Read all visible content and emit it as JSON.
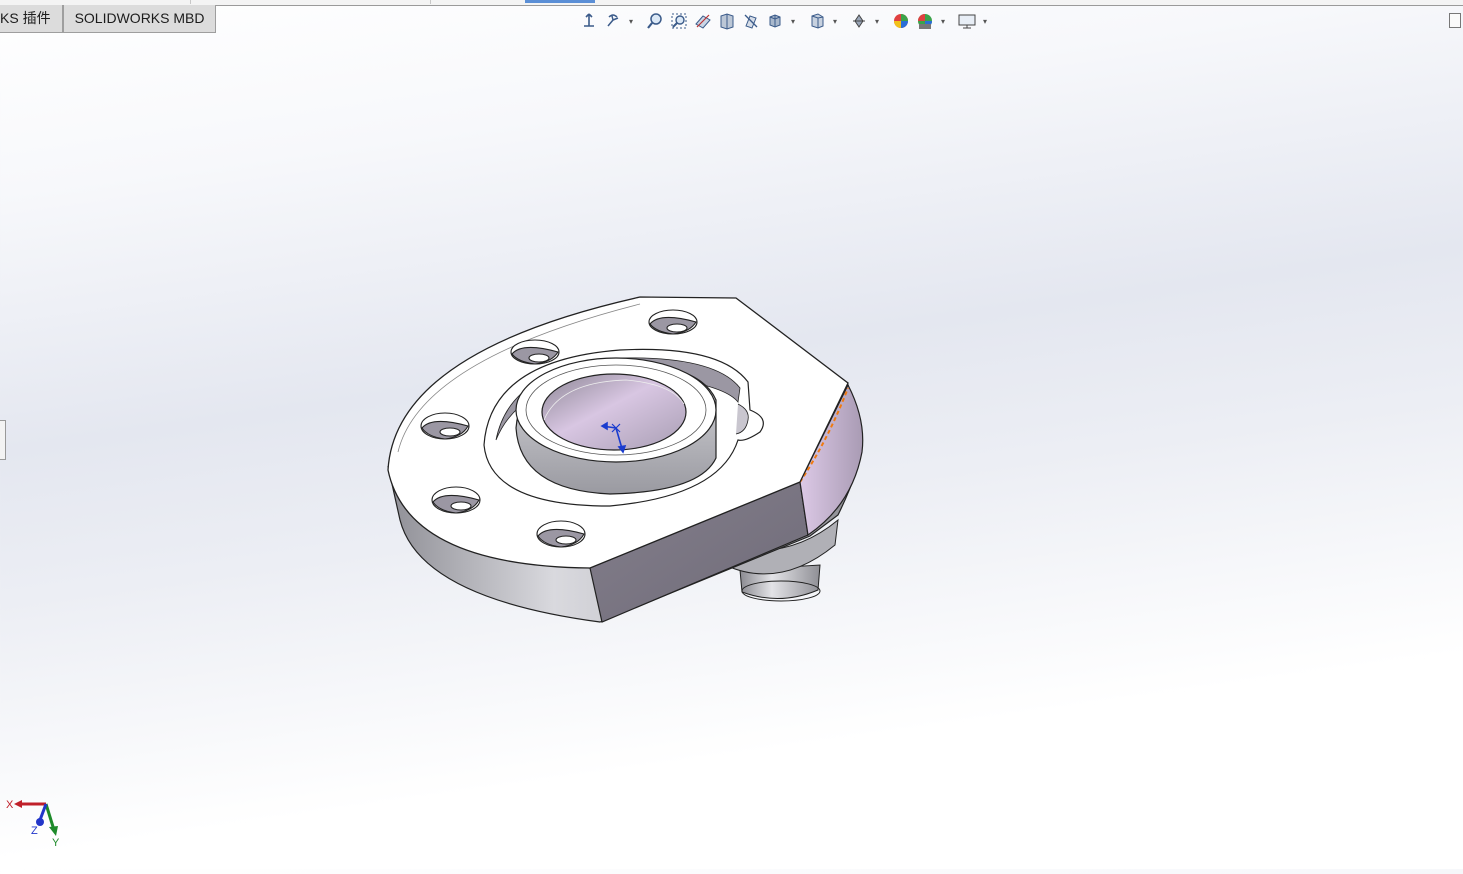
{
  "tabs": [
    {
      "label": "KS 插件"
    },
    {
      "label": "SOLIDWORKS MBD"
    }
  ],
  "heads_up_toolbar": [
    {
      "icon": "zoom-to-fit-icon"
    },
    {
      "icon": "zoom-to-area-icon"
    },
    {
      "icon": "previous-view-icon"
    },
    {
      "icon": "section-view-icon"
    },
    {
      "icon": "dynamic-annotation-views-icon"
    },
    {
      "icon": "view-orientation-icon"
    },
    {
      "icon": "display-style-icon"
    },
    {
      "icon": "hide-show-items-icon"
    },
    {
      "icon": "edit-appearance-icon"
    },
    {
      "icon": "apply-scene-icon"
    },
    {
      "icon": "view-settings-icon"
    }
  ],
  "triad": {
    "x_label": "X",
    "y_label": "Y",
    "z_label": "Z"
  },
  "colors": {
    "selection_highlight": "#f07a10",
    "triad_x": "#c0202a",
    "triad_y": "#1e8a2a",
    "triad_z": "#2236c9",
    "origin": "#1a3ccf"
  }
}
